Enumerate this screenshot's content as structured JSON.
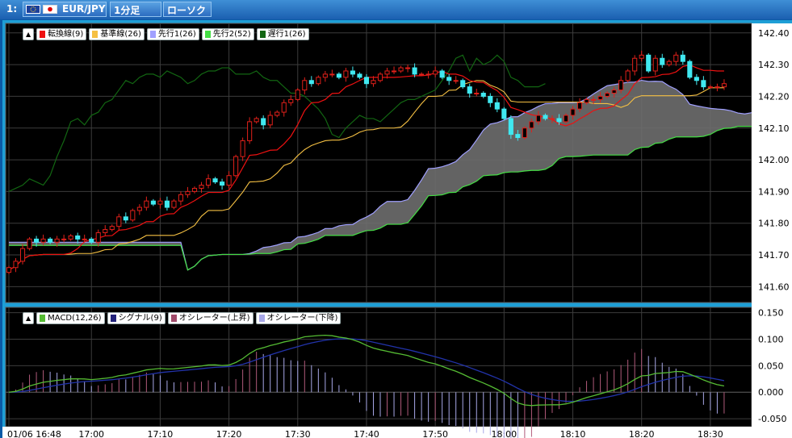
{
  "toolbar": {
    "slot": "1:",
    "symbol": "EUR/JPY",
    "timeframe": "1分足",
    "chart_style": "ローソク"
  },
  "colors": {
    "background": "#000000",
    "up_candle": "#e0201a",
    "down_candle": "#40e8f0",
    "tenkan": "#ee1111",
    "kijun": "#f5c043",
    "senkou1": "#a0a0ff",
    "senkou2": "#44dd44",
    "chikou": "#126612",
    "cloud": "#6e6e6e",
    "macd": "#55bb33",
    "signal": "#2233aa",
    "osc_up": "#b05a7a",
    "osc_down": "#a8a8e8"
  },
  "main_legend": [
    {
      "label": "転換線(9)",
      "color": "#ee1111"
    },
    {
      "label": "基準線(26)",
      "color": "#f5c043"
    },
    {
      "label": "先行1(26)",
      "color": "#a0a0ff"
    },
    {
      "label": "先行2(52)",
      "color": "#44dd44"
    },
    {
      "label": "遅行1(26)",
      "color": "#126612"
    }
  ],
  "sub_legend": [
    {
      "label": "MACD(12,26)",
      "color": "#55bb33"
    },
    {
      "label": "シグナル(9)",
      "color": "#22227a"
    },
    {
      "label": "オシレーター(上昇)",
      "color": "#a04a6a"
    },
    {
      "label": "オシレーター(下降)",
      "color": "#a8a8e8"
    }
  ],
  "collapse_glyph": "▲",
  "chart_data": {
    "type": "candlestick",
    "price_axis": {
      "ylim": [
        141.55,
        142.43
      ],
      "ticks": [
        "142.40",
        "142.30",
        "142.20",
        "142.10",
        "142.00",
        "141.90",
        "141.80",
        "141.70",
        "141.60"
      ]
    },
    "time_axis": {
      "labels": [
        "01/06 16:48",
        "17:00",
        "17:10",
        "17:20",
        "17:30",
        "17:40",
        "17:50",
        "18:00",
        "18:10",
        "18:20",
        "18:30"
      ],
      "label_minutes": [
        0,
        12,
        22,
        32,
        42,
        52,
        62,
        72,
        82,
        92,
        102
      ]
    },
    "close": [
      141.66,
      141.68,
      141.72,
      141.75,
      141.74,
      141.75,
      141.74,
      141.75,
      141.75,
      141.76,
      141.75,
      141.75,
      141.74,
      141.77,
      141.78,
      141.79,
      141.82,
      141.81,
      141.84,
      141.85,
      141.87,
      141.86,
      141.87,
      141.85,
      141.87,
      141.89,
      141.9,
      141.91,
      141.92,
      141.94,
      141.93,
      141.92,
      141.95,
      142.01,
      142.06,
      142.12,
      142.13,
      142.11,
      142.14,
      142.15,
      142.18,
      142.19,
      142.22,
      142.25,
      142.24,
      142.26,
      142.27,
      142.27,
      142.26,
      142.28,
      142.27,
      142.26,
      142.24,
      142.25,
      142.27,
      142.28,
      142.28,
      142.29,
      142.29,
      142.27,
      142.27,
      142.27,
      142.28,
      142.26,
      142.25,
      142.25,
      142.23,
      142.21,
      142.21,
      142.2,
      142.18,
      142.16,
      142.13,
      142.08,
      142.07,
      142.1,
      142.12,
      142.14,
      142.13,
      142.13,
      142.12,
      142.14,
      142.16,
      142.18,
      142.19,
      142.19,
      142.2,
      142.21,
      142.22,
      142.25,
      142.28,
      142.32,
      142.33,
      142.28,
      142.32,
      142.3,
      142.31,
      142.33,
      142.31,
      142.26,
      142.25,
      142.23,
      142.23,
      142.23,
      142.24
    ],
    "macd": {
      "ylim": [
        -0.065,
        0.16
      ],
      "ticks": [
        "0.150",
        "0.100",
        "0.050",
        "0.000",
        "-0.050"
      ]
    },
    "x_range_minutes": [
      0,
      108
    ]
  }
}
